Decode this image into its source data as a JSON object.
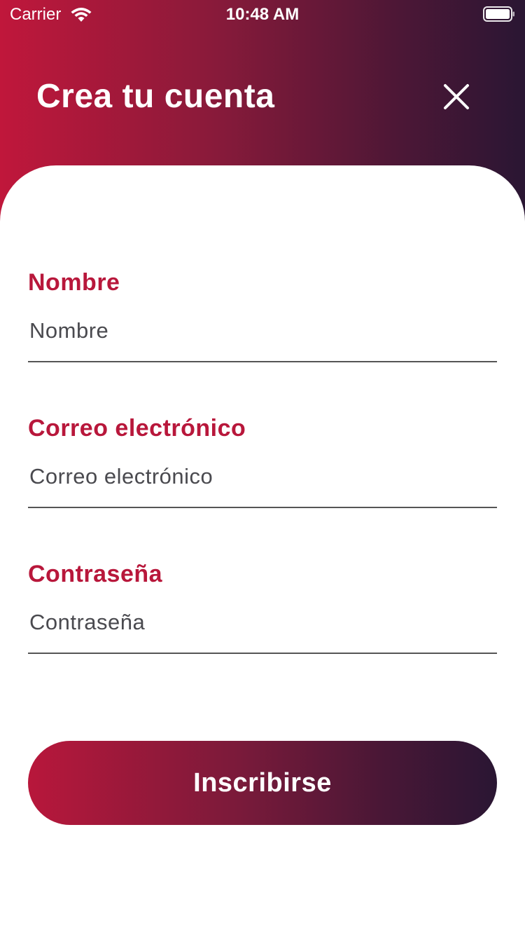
{
  "status_bar": {
    "carrier": "Carrier",
    "time": "10:48 AM",
    "wifi_icon": "wifi-icon",
    "battery_icon": "battery-icon"
  },
  "header": {
    "title": "Crea tu cuenta",
    "close_icon": "close-icon"
  },
  "form": {
    "name": {
      "label": "Nombre",
      "value": "",
      "placeholder": "Nombre"
    },
    "email": {
      "label": "Correo electrónico",
      "value": "",
      "placeholder": "Correo electrónico"
    },
    "password": {
      "label": "Contraseña",
      "value": "",
      "placeholder": "Contraseña"
    },
    "submit_label": "Inscribirse"
  },
  "colors": {
    "accent": "#b8173b",
    "gradient_start": "#c0173b",
    "gradient_end": "#2a1633"
  }
}
